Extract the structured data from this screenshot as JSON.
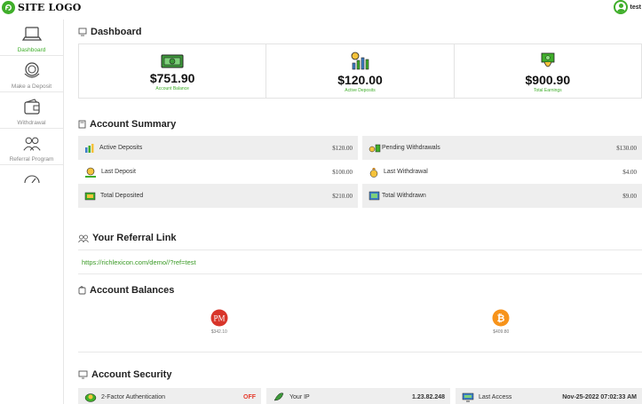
{
  "header": {
    "logo_text": "SITE LOGO",
    "username": "test"
  },
  "sidebar": {
    "items": [
      {
        "label": "Dashboard",
        "icon": "laptop-icon",
        "active": true
      },
      {
        "label": "Make a Deposit",
        "icon": "coins-icon",
        "active": false
      },
      {
        "label": "Withdrawal",
        "icon": "wallet-icon",
        "active": false
      },
      {
        "label": "Referral Program",
        "icon": "users-icon",
        "active": false
      },
      {
        "label": "",
        "icon": "gauge-icon",
        "active": false
      }
    ]
  },
  "dashboard": {
    "title": "Dashboard",
    "stats": [
      {
        "value": "$751.90",
        "label": "Account Balance",
        "icon": "cash-icon"
      },
      {
        "value": "$120.00",
        "label": "Active Deposits",
        "icon": "growth-chart-icon"
      },
      {
        "value": "$900.90",
        "label": "Total Earnings",
        "icon": "earnings-icon"
      }
    ]
  },
  "summary": {
    "title": "Account Summary",
    "rows": [
      [
        {
          "label": "Active Deposits",
          "value": "$120.00",
          "icon": "bar-chart-icon"
        },
        {
          "label": "Pending Withdrawals",
          "value": "$130.00",
          "icon": "pending-icon"
        }
      ],
      [
        {
          "label": "Last Deposit",
          "value": "$100.00",
          "icon": "coin-hand-icon"
        },
        {
          "label": "Last Withdrawal",
          "value": "$4.00",
          "icon": "money-bag-icon"
        }
      ],
      [
        {
          "label": "Total Deposited",
          "value": "$210.00",
          "icon": "money-stack-icon"
        },
        {
          "label": "Total Withdrawn",
          "value": "$9.00",
          "icon": "cash-out-icon"
        }
      ]
    ]
  },
  "referral": {
    "title": "Your Referral Link",
    "link": "https://richlexicon.com/demo//?ref=test"
  },
  "balances": {
    "title": "Account Balances",
    "items": [
      {
        "symbol": "PM",
        "amount": "$342.10",
        "color": "#d8352a",
        "icon": "perfect-money-icon"
      },
      {
        "symbol": "₿",
        "amount": "$409.80",
        "color": "#f7931a",
        "icon": "bitcoin-icon"
      }
    ]
  },
  "security": {
    "title": "Account Security",
    "items": [
      {
        "label": "2-Factor Authentication",
        "value": "OFF",
        "icon": "shield-key-icon"
      },
      {
        "label": "Your IP",
        "value": "1.23.82.248",
        "icon": "network-icon"
      },
      {
        "label": "Last Access",
        "value": "Nov-25-2022 07:02:33 AM",
        "icon": "monitor-icon"
      }
    ]
  },
  "colors": {
    "accent": "#3fae2a",
    "danger": "#e53b2c"
  }
}
